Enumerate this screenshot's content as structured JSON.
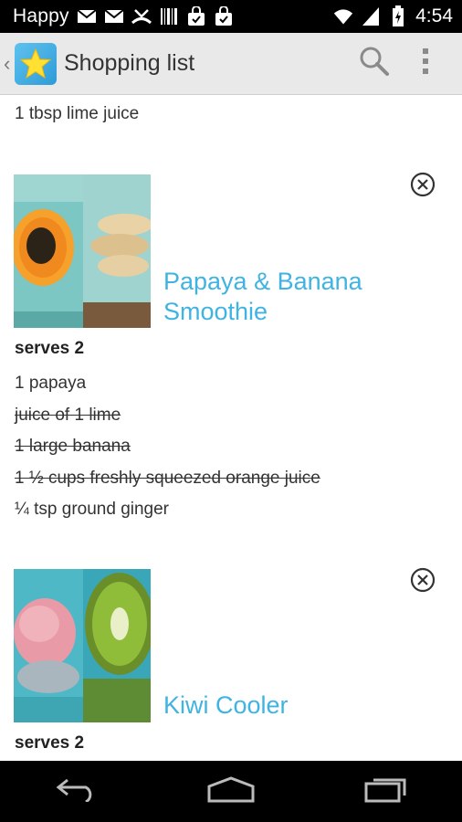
{
  "status_bar": {
    "carrier": "Happy",
    "time": "4:54",
    "icons": [
      "gmail-icon",
      "gmail-icon",
      "missed-call-icon",
      "barcode-icon",
      "shopping-bag-icon",
      "shopping-bag-icon",
      "wifi-icon",
      "signal-icon",
      "battery-icon"
    ]
  },
  "action_bar": {
    "title": "Shopping list",
    "app_icon": "star-icon",
    "actions": [
      "search-icon",
      "overflow-menu-icon"
    ]
  },
  "list": {
    "partial_item": "1 tbsp lime juice",
    "recipes": [
      {
        "title_line1": "Papaya & Banana",
        "title_line2": "Smoothie",
        "serves": "serves 2",
        "ingredients": [
          {
            "text": "1  papaya",
            "checked": false
          },
          {
            "text": "juice of 1 lime",
            "checked": true
          },
          {
            "text": "1  large banana",
            "checked": true
          },
          {
            "text": "1 ½ cups freshly squeezed orange juice",
            "checked": true
          },
          {
            "text": "¼ tsp ground ginger",
            "checked": false
          }
        ]
      },
      {
        "title_line1": "Kiwi Cooler",
        "serves": "serves 2"
      }
    ]
  },
  "colors": {
    "accent": "#3fb3e1",
    "action_bar_bg": "#e9e9e9",
    "system_bar_bg": "#000000"
  }
}
